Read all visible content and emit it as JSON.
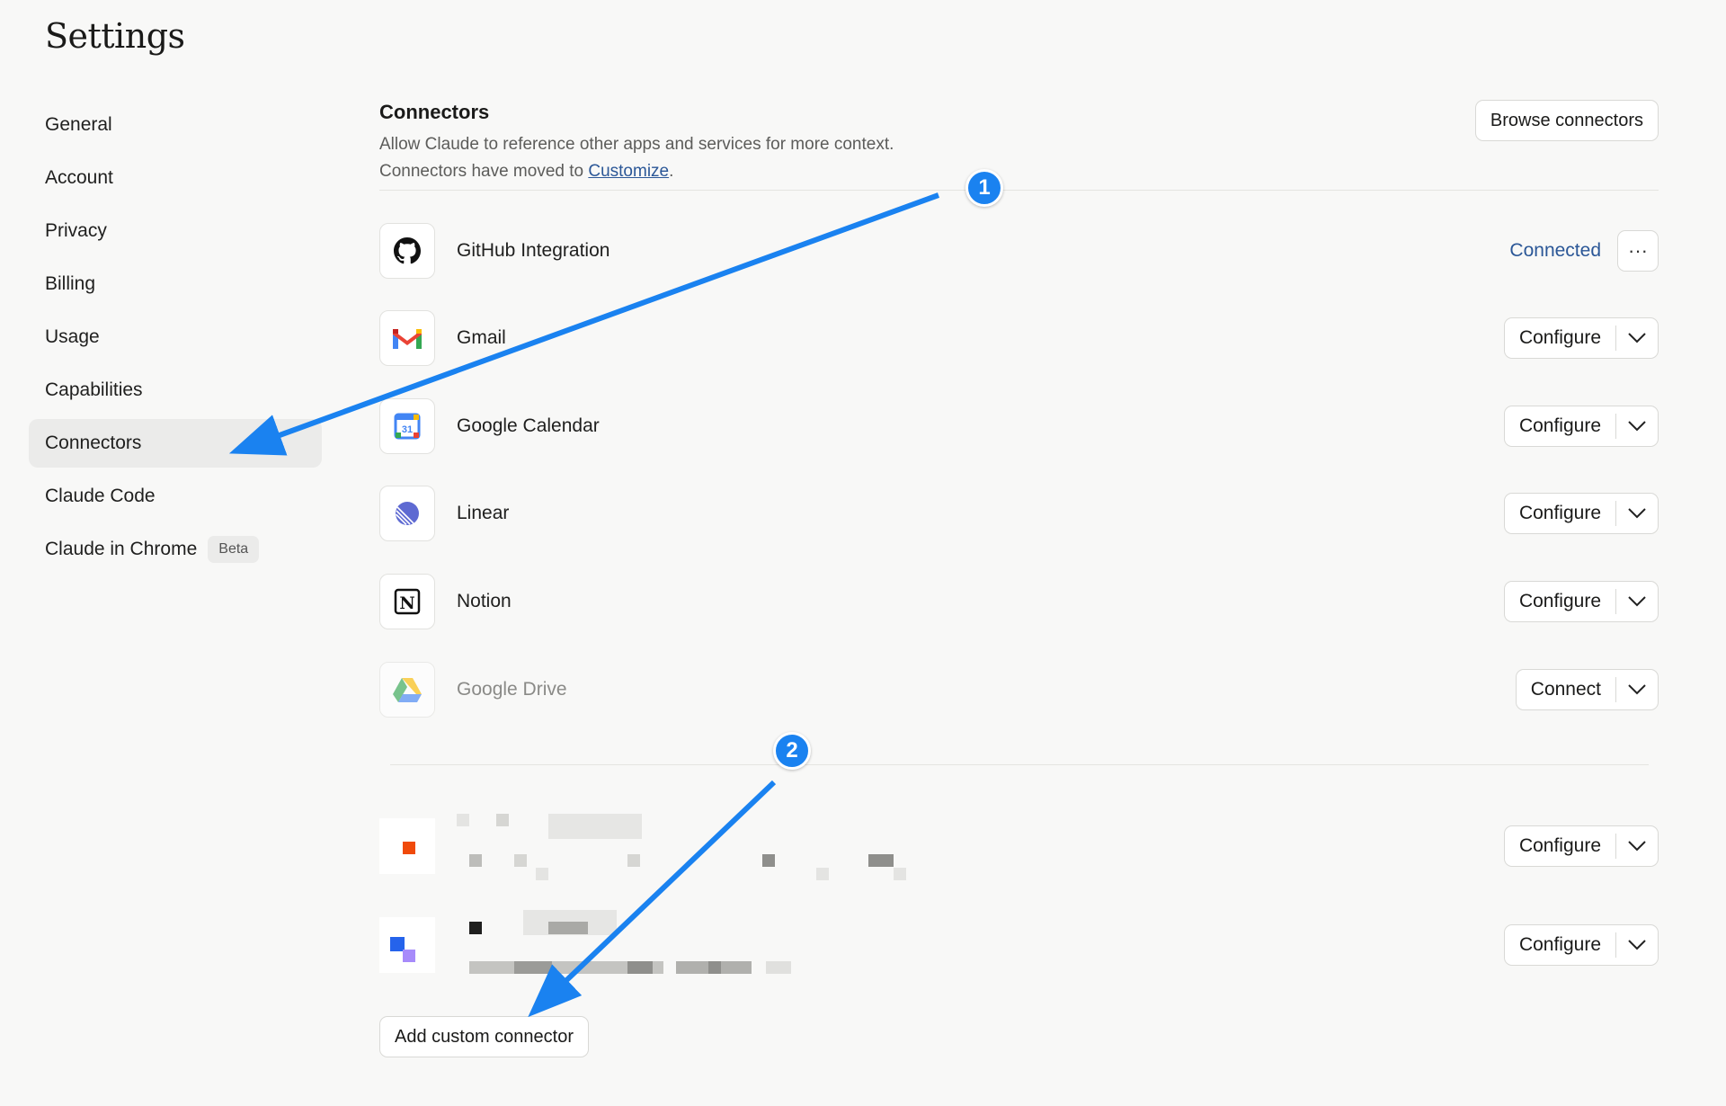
{
  "page": {
    "title": "Settings"
  },
  "sidebar": {
    "items": [
      {
        "label": "General"
      },
      {
        "label": "Account"
      },
      {
        "label": "Privacy"
      },
      {
        "label": "Billing"
      },
      {
        "label": "Usage"
      },
      {
        "label": "Capabilities"
      },
      {
        "label": "Connectors",
        "active": true
      },
      {
        "label": "Claude Code"
      },
      {
        "label": "Claude in Chrome",
        "badge": "Beta"
      }
    ]
  },
  "connectors": {
    "title": "Connectors",
    "description": "Allow Claude to reference other apps and services for more context.",
    "moved_prefix": "Connectors have moved to ",
    "moved_link": "Customize",
    "moved_suffix": ".",
    "browse_label": "Browse connectors",
    "items": [
      {
        "name": "GitHub Integration",
        "icon": "github-icon",
        "status": "Connected",
        "more": "···"
      },
      {
        "name": "Gmail",
        "icon": "gmail-icon",
        "action": "Configure"
      },
      {
        "name": "Google Calendar",
        "icon": "google-calendar-icon",
        "icon_text": "31",
        "action": "Configure"
      },
      {
        "name": "Linear",
        "icon": "linear-icon",
        "action": "Configure"
      },
      {
        "name": "Notion",
        "icon": "notion-icon",
        "icon_text": "N",
        "action": "Configure"
      },
      {
        "name": "Google Drive",
        "icon": "google-drive-icon",
        "action": "Connect"
      }
    ],
    "custom_items": [
      {
        "action": "Configure"
      },
      {
        "action": "Configure"
      }
    ],
    "add_custom_label": "Add custom connector"
  },
  "annotations": {
    "step1": "1",
    "step2": "2",
    "arrow_color": "#1a82f0"
  }
}
